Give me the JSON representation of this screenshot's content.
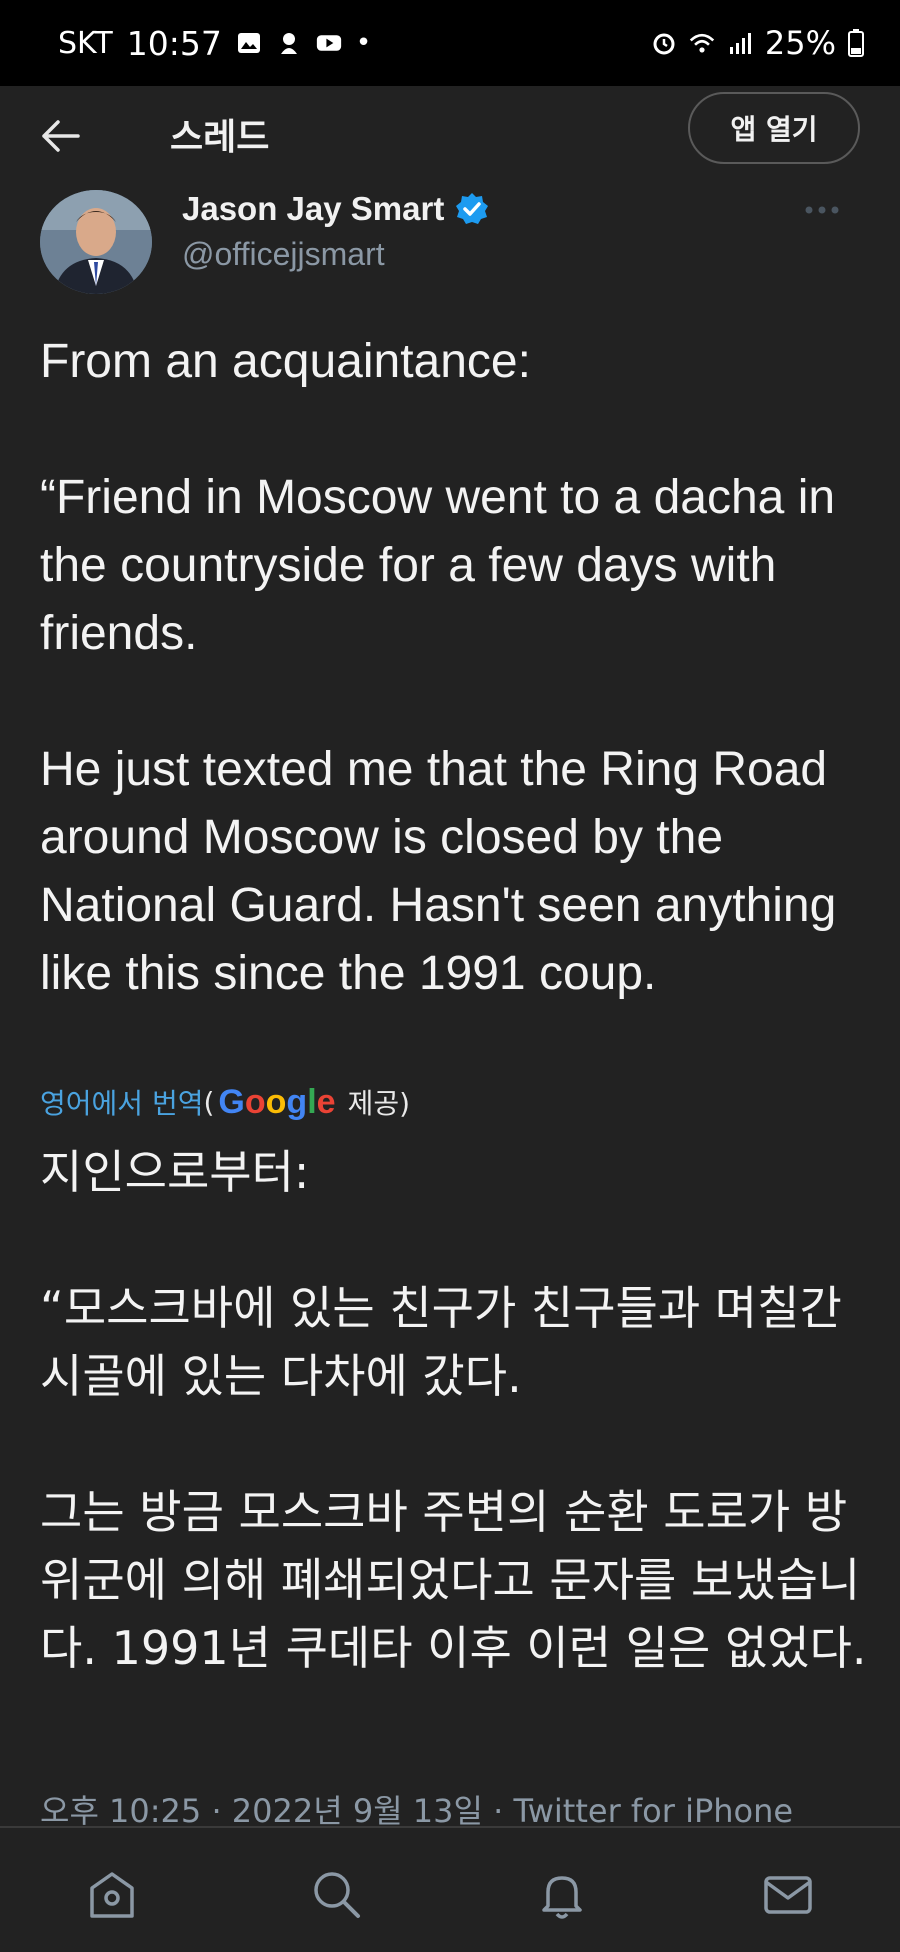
{
  "status_bar": {
    "carrier": "SKT",
    "time": "10:57",
    "battery": "25%"
  },
  "header": {
    "title": "스레드",
    "open_app_label": "앱 열기"
  },
  "tweet": {
    "author_name": "Jason Jay Smart",
    "author_handle": "@officejjsmart",
    "text": "From an acquaintance:\n\n“Friend in Moscow went to a dacha in the countryside for a few days with friends.\n\nHe just texted me that the Ring Road around Moscow is closed by the National Guard. Hasn't seen anything like this since the 1991 coup.",
    "translation_link": "영어에서 번역",
    "translation_provider_prefix": "(",
    "translation_provider": "Google",
    "translation_provider_suffix": "제공)",
    "translated_text": "지인으로부터:\n\n“모스크바에 있는 친구가 친구들과 며칠간 시골에 있는 다차에 갔다.\n\n그는 방금 모스크바 주변의 순환 도로가 방위군에 의해 폐쇄되었다고 문자를 보냈습니다. 1991년 쿠데타 이후 이런 일은 없었다.",
    "meta": "오후 10:25 · 2022년 9월 13일 · Twitter for iPhone"
  },
  "icons": {
    "back": "back-arrow-icon",
    "verified": "verified-badge-icon",
    "more": "more-options-icon",
    "tabs": [
      "home-icon",
      "search-icon",
      "notifications-icon",
      "messages-icon"
    ]
  },
  "colors": {
    "background": "#222222",
    "link": "#4aa3e0",
    "verified": "#1d9bf0",
    "muted": "#8b98a5"
  }
}
